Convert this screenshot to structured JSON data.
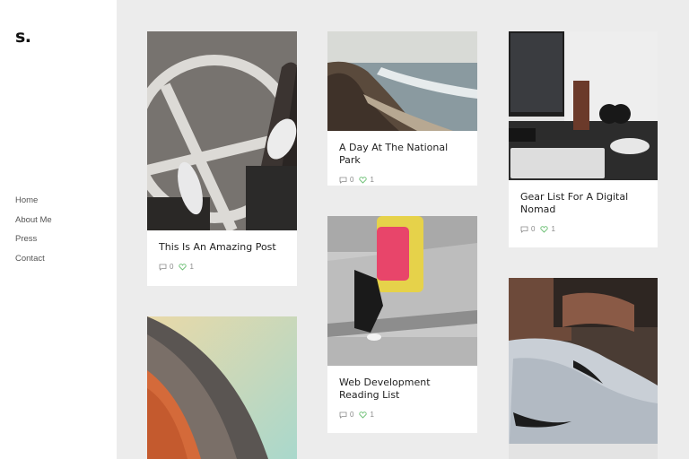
{
  "logo": "s.",
  "nav": {
    "items": [
      {
        "label": "Home"
      },
      {
        "label": "About Me"
      },
      {
        "label": "Press"
      },
      {
        "label": "Contact"
      }
    ]
  },
  "posts": [
    {
      "title": "This Is An Amazing Post",
      "comments": "0",
      "likes": "1",
      "image": "skateboard-feet-photo"
    },
    {
      "title": "A Day At The National Park",
      "comments": "0",
      "likes": "1",
      "image": "coastline-photo"
    },
    {
      "title": "Gear List For A Digital Nomad",
      "comments": "0",
      "likes": "1",
      "image": "desk-headphones-photo"
    },
    {
      "title": "Web Development Reading List",
      "comments": "0",
      "likes": "1",
      "image": "backpack-photo"
    },
    {
      "image": "architecture-photo"
    },
    {
      "image": "sneaker-photo"
    }
  ],
  "colors": {
    "comment_icon": "#8a8a8a",
    "like_icon": "#6bbf73",
    "background": "#ececec"
  }
}
